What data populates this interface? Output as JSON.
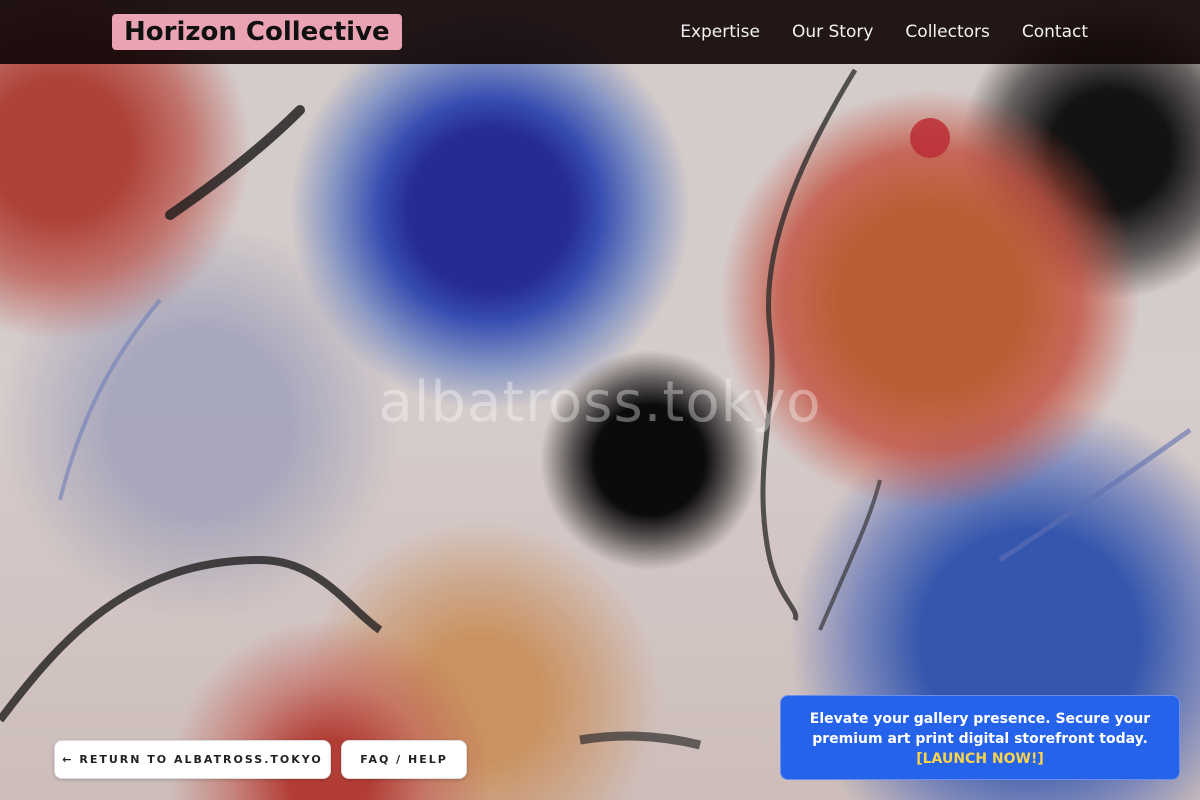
{
  "header": {
    "brand": "Horizon Collective",
    "nav": [
      "Expertise",
      "Our Story",
      "Collectors",
      "Contact"
    ]
  },
  "hero": {
    "watermark": "albatross.tokyo"
  },
  "footer_buttons": {
    "return_label": "← RETURN TO ALBATROSS.TOKYO",
    "faq_label": "FAQ / HELP"
  },
  "promo": {
    "text": "Elevate your gallery presence. Secure your premium art print digital storefront today.",
    "cta": "[LAUNCH NOW!]"
  },
  "colors": {
    "topbar": "#12060a",
    "brand_bg": "#e9a3b3",
    "promo_bg": "#2563eb",
    "promo_cta": "#fcd34d"
  }
}
